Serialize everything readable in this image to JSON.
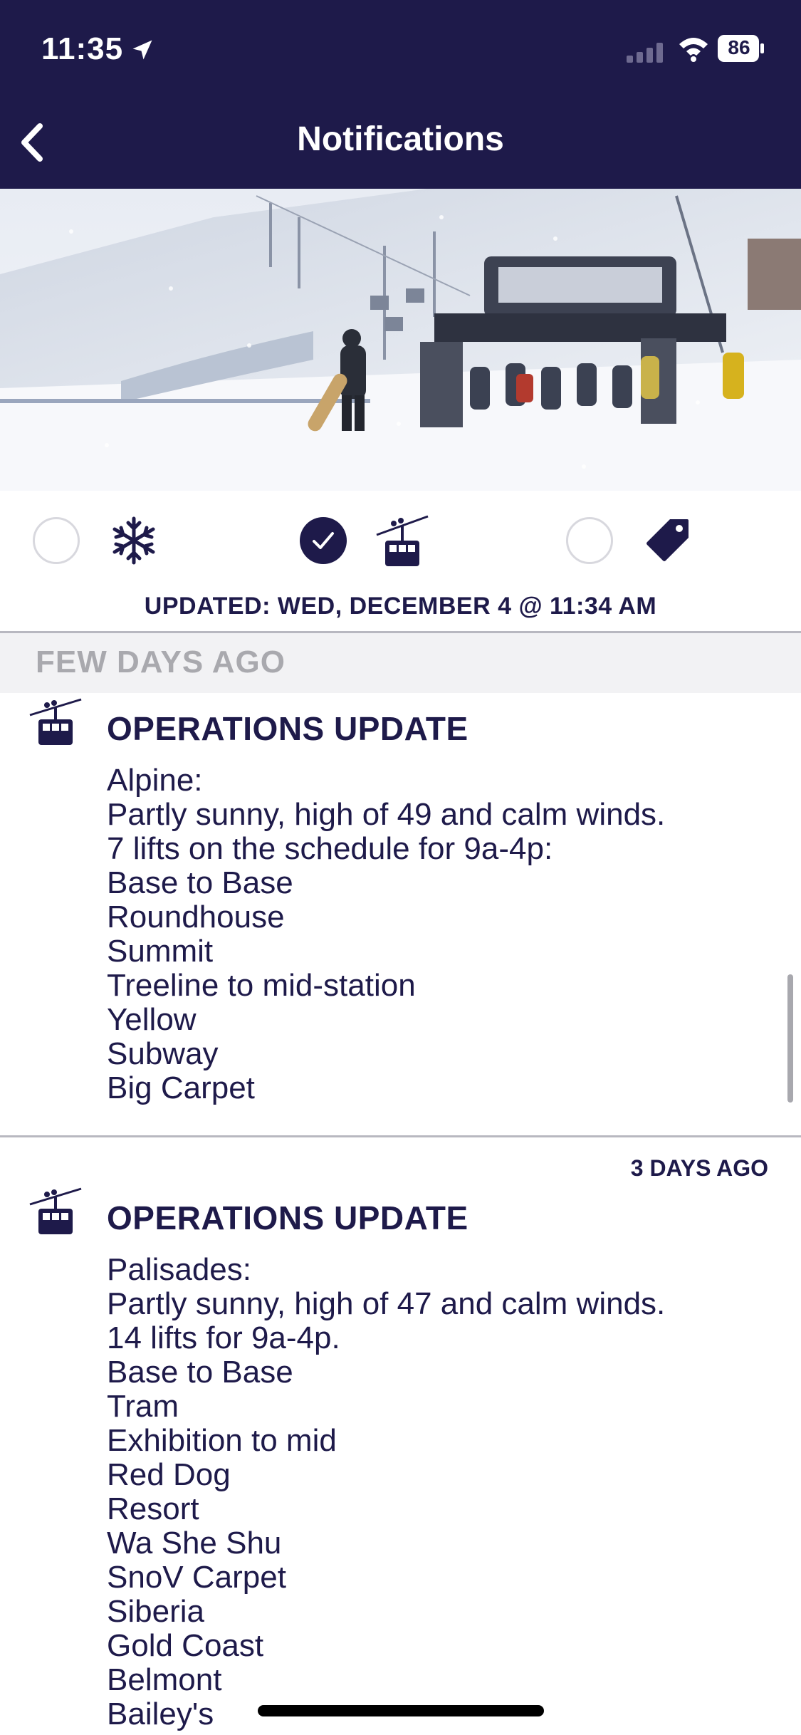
{
  "status_bar": {
    "time": "11:35",
    "battery": "86"
  },
  "header": {
    "title": "Notifications"
  },
  "filters": [
    {
      "icon": "snowflake-icon",
      "checked": false
    },
    {
      "icon": "gondola-icon",
      "checked": true
    },
    {
      "icon": "tag-icon",
      "checked": false
    }
  ],
  "updated_text": "UPDATED: WED, DECEMBER 4 @ 11:34 AM",
  "section_header": "FEW DAYS AGO",
  "notifications": [
    {
      "title": "OPERATIONS UPDATE",
      "timestamp": "",
      "lines": [
        "Alpine:",
        "Partly sunny, high of 49 and calm winds.",
        "7 lifts on the schedule for 9a-4p:",
        "Base to Base",
        "Roundhouse",
        "Summit",
        "Treeline to mid-station",
        "Yellow",
        "Subway",
        "Big Carpet"
      ]
    },
    {
      "title": "OPERATIONS UPDATE",
      "timestamp": "3 DAYS AGO",
      "lines": [
        "Palisades:",
        "Partly sunny, high of 47 and calm winds.",
        "14 lifts for 9a-4p.",
        "Base to Base",
        "Tram",
        "Exhibition to mid",
        "Red Dog",
        "Resort",
        "Wa She Shu",
        "SnoV Carpet",
        "Siberia",
        "Gold Coast",
        "Belmont",
        "Bailey's"
      ]
    }
  ],
  "colors": {
    "brand": "#1e1a4a",
    "section_bg": "#f2f2f4",
    "section_text": "#a9a9ae"
  }
}
